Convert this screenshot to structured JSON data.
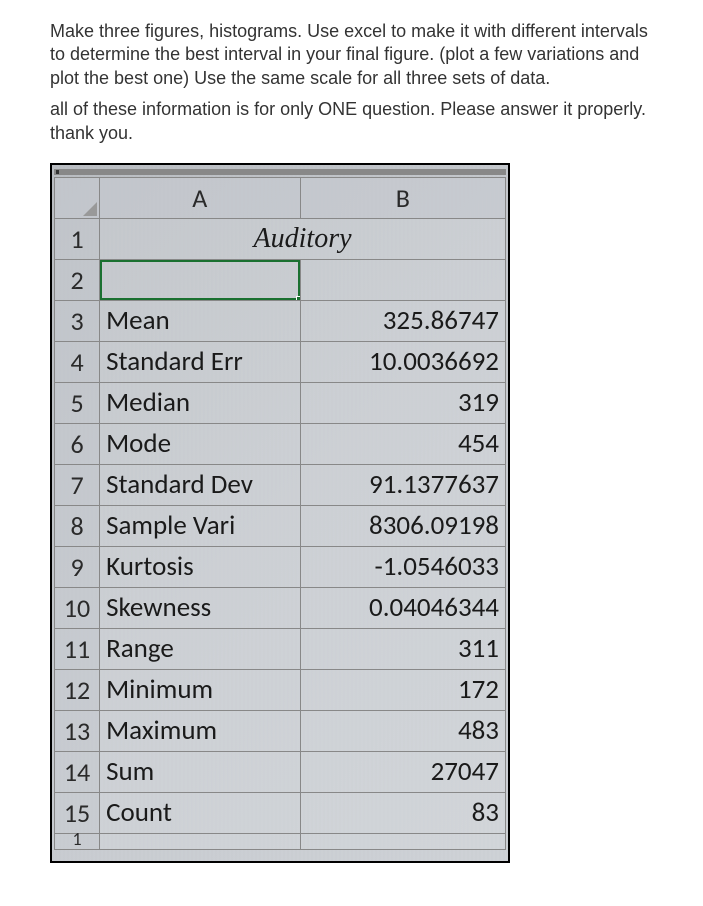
{
  "instructions": {
    "line1": "Make three figures, histograms. Use excel to make it with different intervals to determine the best interval in your final figure. (plot a few variations and plot the best one) Use the same scale for all three sets of data.",
    "line2": "all of these information is for only ONE question. Please answer it properly. thank you."
  },
  "spreadsheet": {
    "columns": [
      "A",
      "B"
    ],
    "merged_title": "Auditory",
    "rows": [
      {
        "num": "1"
      },
      {
        "num": "2"
      },
      {
        "num": "3",
        "label": "Mean",
        "value": "325.86747"
      },
      {
        "num": "4",
        "label": "Standard Err",
        "value": "10.0036692"
      },
      {
        "num": "5",
        "label": "Median",
        "value": "319"
      },
      {
        "num": "6",
        "label": "Mode",
        "value": "454"
      },
      {
        "num": "7",
        "label": "Standard Dev",
        "value": "91.1377637"
      },
      {
        "num": "8",
        "label": "Sample Vari",
        "value": "8306.09198"
      },
      {
        "num": "9",
        "label": "Kurtosis",
        "value": "-1.0546033"
      },
      {
        "num": "10",
        "label": "Skewness",
        "value": "0.04046344"
      },
      {
        "num": "11",
        "label": "Range",
        "value": "311"
      },
      {
        "num": "12",
        "label": "Minimum",
        "value": "172"
      },
      {
        "num": "13",
        "label": "Maximum",
        "value": "483"
      },
      {
        "num": "14",
        "label": "Sum",
        "value": "27047"
      },
      {
        "num": "15",
        "label": "Count",
        "value": "83"
      }
    ],
    "partial_row_num": "1"
  }
}
